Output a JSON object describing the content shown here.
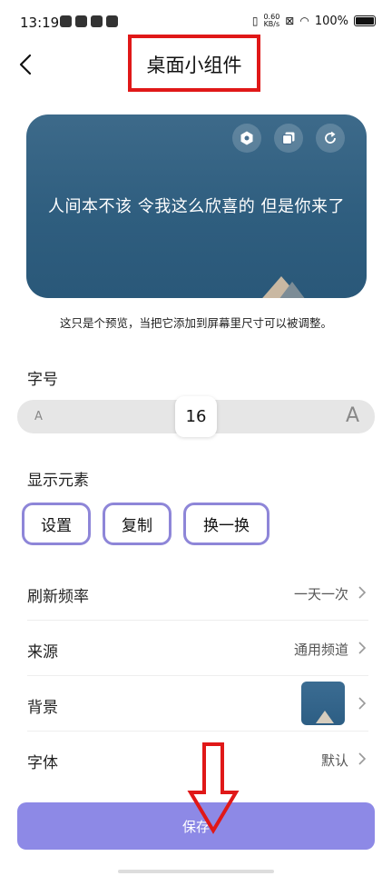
{
  "status_bar": {
    "time": "13:19",
    "net_speed_value": "0.60",
    "net_speed_unit": "KB/s",
    "battery_text": "100%"
  },
  "nav": {
    "title": "桌面小组件",
    "back_icon": "chevron-left-icon"
  },
  "preview": {
    "quote": "人间本不该 令我这么欣喜的 但是你来了",
    "icons": [
      "settings-icon",
      "copy-icon",
      "refresh-icon"
    ],
    "hint": "这只是个预览，当把它添加到屏幕里尺寸可以被调整。"
  },
  "font_size": {
    "label": "字号",
    "small_label": "A",
    "large_label": "A",
    "value": "16"
  },
  "display_elements": {
    "label": "显示元素",
    "chips": [
      "设置",
      "复制",
      "换一换"
    ]
  },
  "settings": {
    "rows": [
      {
        "label": "刷新频率",
        "value": "一天一次"
      },
      {
        "label": "来源",
        "value": "通用频道"
      },
      {
        "label": "背景",
        "value": ""
      },
      {
        "label": "字体",
        "value": "默认"
      }
    ]
  },
  "save_button": {
    "label": "保存"
  },
  "colors": {
    "accent": "#8d89e6",
    "chip_border": "#8e86d8",
    "annotation_red": "#e01818",
    "card_bg": "#2f5e7f"
  }
}
